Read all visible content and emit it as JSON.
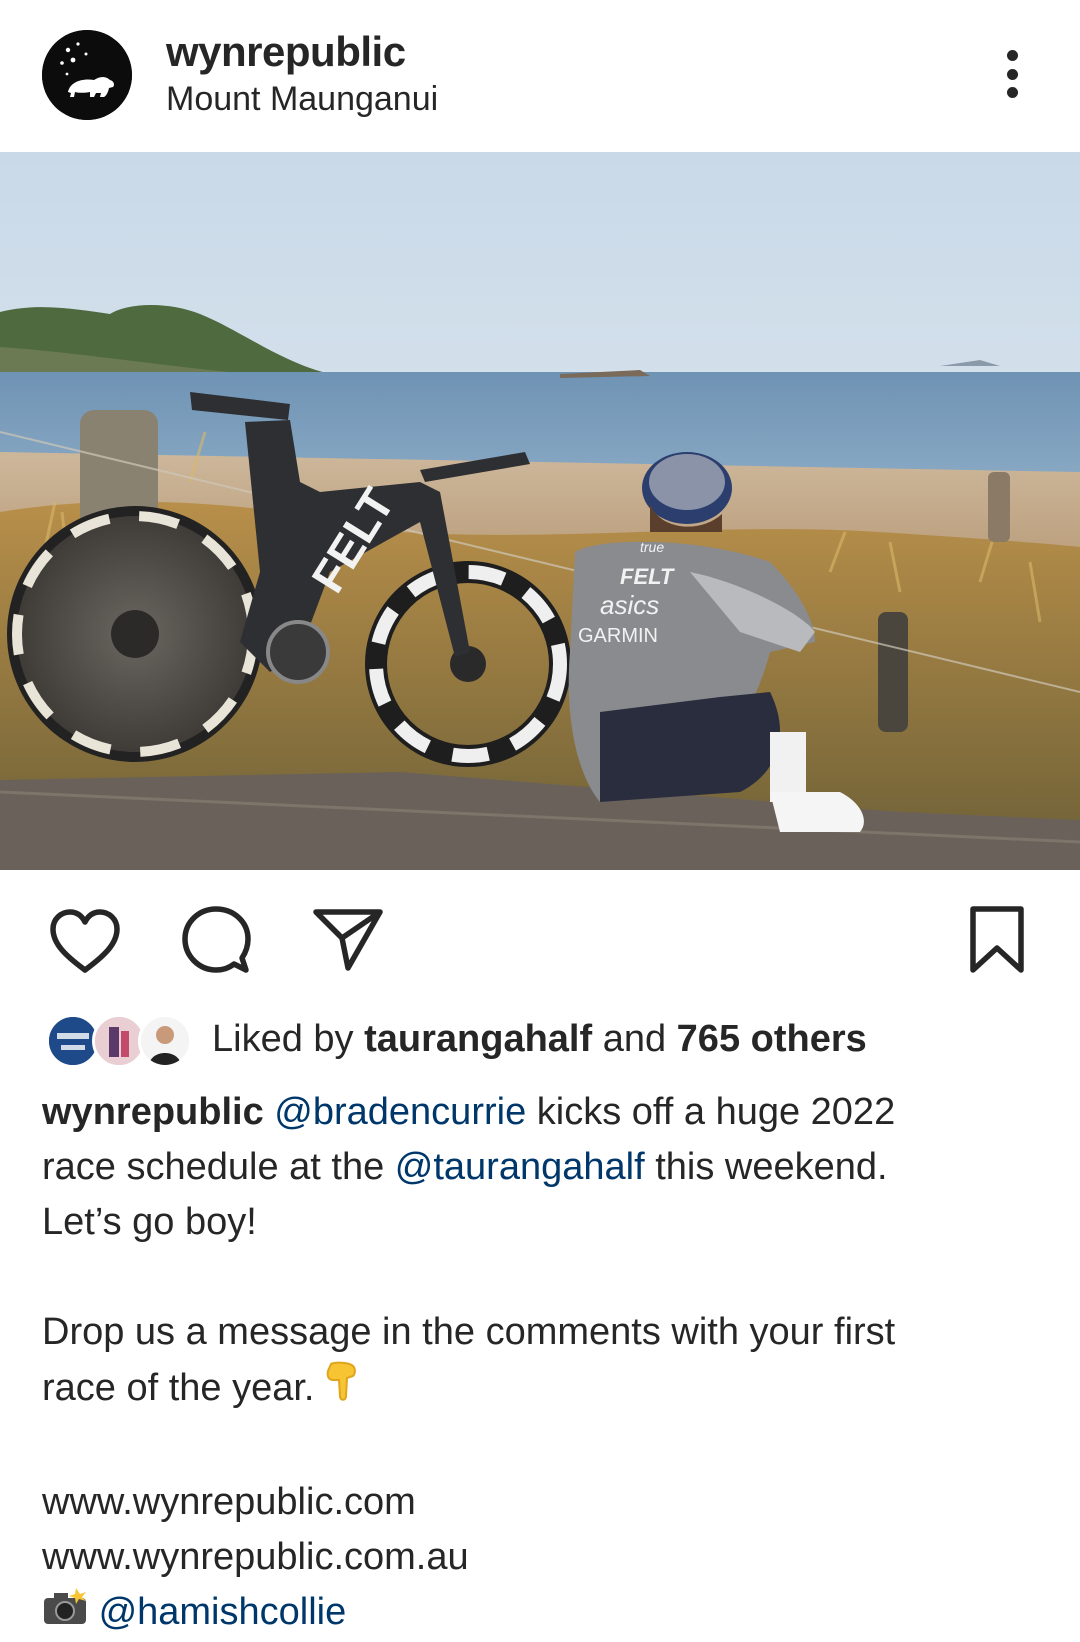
{
  "post": {
    "username": "wynrepublic",
    "location": "Mount Maunganui"
  },
  "image": {
    "jersey_brand_1": "true",
    "jersey_brand_2": "FELT",
    "jersey_brand_3": "asics",
    "jersey_brand_4": "GARMIN",
    "bike_frame_text": "FELT"
  },
  "likes": {
    "prefix": "Liked by ",
    "user": "taurangahalf",
    "middle": " and ",
    "others": "765 others"
  },
  "caption": {
    "author": "wynrepublic",
    "mention_1": "@bradencurrie",
    "line1_rest": " kicks off a huge 2022",
    "line2_start": "race schedule at the ",
    "mention_2": "@taurangahalf",
    "line2_rest": " this weekend.",
    "line3": "Let’s go boy!",
    "para2_line1": "Drop us a message in the comments with your first",
    "para2_line2": "race of the year. ",
    "link_1": "www.wynrepublic.com",
    "link_2": "www.wynrepublic.com.au",
    "photo_credit": "@hamishcollie"
  },
  "icons": {
    "like": "heart-icon",
    "comment": "comment-bubble-icon",
    "share": "paper-plane-icon",
    "save": "bookmark-icon",
    "more": "more-options-icon",
    "pointing": "pointing-down-emoji",
    "camera": "camera-flash-emoji"
  },
  "colors": {
    "text": "#262626",
    "mention": "#00376b",
    "avatar_bg": "#0c0c0c"
  }
}
